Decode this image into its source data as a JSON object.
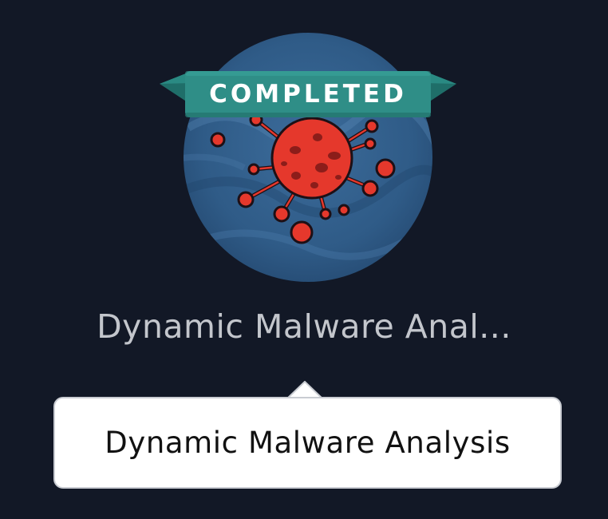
{
  "badge": {
    "status_label": "COMPLETED",
    "icon": "virus-icon",
    "colors": {
      "circle": "#2f5b87",
      "ribbon": "#2a8a83",
      "virus": "#e5382c"
    }
  },
  "course": {
    "title_truncated": "Dynamic Malware Anal...",
    "title_full": "Dynamic Malware Analysis"
  },
  "background_color": "#121826"
}
